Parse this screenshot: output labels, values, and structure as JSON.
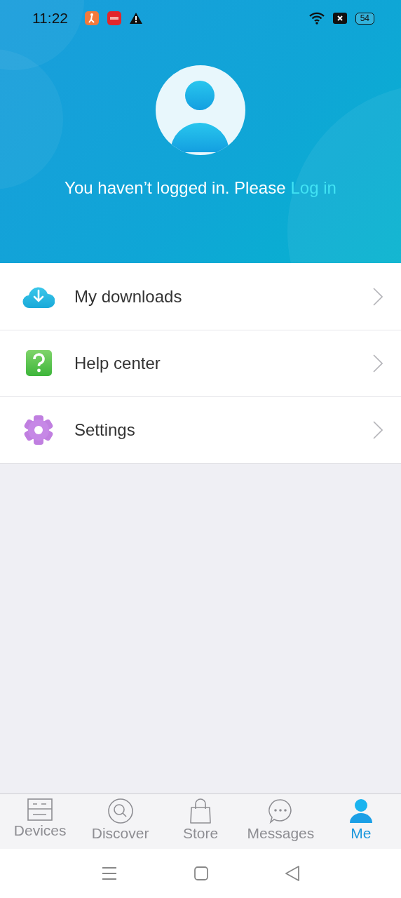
{
  "status_bar": {
    "time": "11:22",
    "battery": "54"
  },
  "profile": {
    "prompt": "You haven’t logged in. Please",
    "login_link": "Log in"
  },
  "menu": [
    {
      "kind": "download",
      "label": "My downloads"
    },
    {
      "kind": "help",
      "label": "Help center"
    },
    {
      "kind": "settings",
      "label": "Settings"
    }
  ],
  "tabs": [
    {
      "kind": "devices",
      "label": "Devices",
      "selected": false
    },
    {
      "kind": "discover",
      "label": "Discover",
      "selected": false
    },
    {
      "kind": "store",
      "label": "Store",
      "selected": false
    },
    {
      "kind": "messages",
      "label": "Messages",
      "selected": false
    },
    {
      "kind": "me",
      "label": "Me",
      "selected": true
    }
  ]
}
